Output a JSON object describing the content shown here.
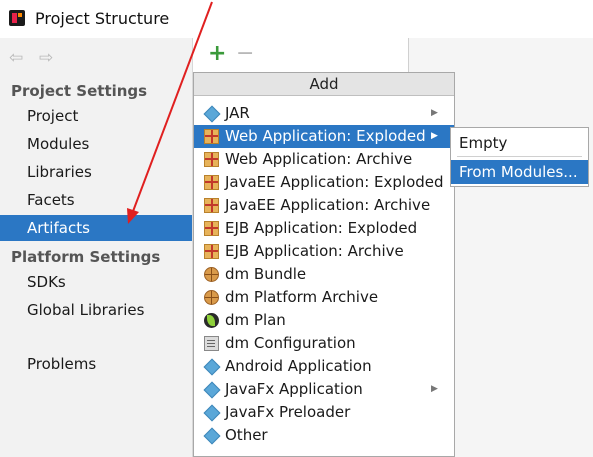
{
  "window": {
    "title": "Project Structure",
    "icon": "intellij-app-icon"
  },
  "nav_arrows": {
    "back": "⇦",
    "forward": "⇨"
  },
  "sidebar": {
    "project_settings_header": "Project Settings",
    "project_items": [
      {
        "label": "Project"
      },
      {
        "label": "Modules"
      },
      {
        "label": "Libraries"
      },
      {
        "label": "Facets"
      },
      {
        "label": "Artifacts",
        "selected": true
      }
    ],
    "platform_settings_header": "Platform Settings",
    "platform_items": [
      {
        "label": "SDKs"
      },
      {
        "label": "Global Libraries"
      }
    ],
    "problems_label": "Problems"
  },
  "toolbar": {
    "add_symbol": "+",
    "remove_symbol": "−"
  },
  "add_menu": {
    "header": "Add",
    "items": [
      {
        "label": "JAR",
        "icon": "jar-diamond-icon",
        "has_submenu": true
      },
      {
        "label": "Web Application: Exploded",
        "icon": "web-exploded-icon",
        "has_submenu": true,
        "highlighted": true
      },
      {
        "label": "Web Application: Archive",
        "icon": "web-archive-icon"
      },
      {
        "label": "JavaEE Application: Exploded",
        "icon": "javaee-exploded-icon"
      },
      {
        "label": "JavaEE Application: Archive",
        "icon": "javaee-archive-icon"
      },
      {
        "label": "EJB Application: Exploded",
        "icon": "ejb-exploded-icon"
      },
      {
        "label": "EJB Application: Archive",
        "icon": "ejb-archive-icon"
      },
      {
        "label": "dm Bundle",
        "icon": "dm-bundle-globe-icon"
      },
      {
        "label": "dm Platform Archive",
        "icon": "dm-platform-globe-icon"
      },
      {
        "label": "dm Plan",
        "icon": "dm-plan-leaf-icon"
      },
      {
        "label": "dm Configuration",
        "icon": "dm-configuration-doc-icon"
      },
      {
        "label": "Android Application",
        "icon": "android-diamond-icon"
      },
      {
        "label": "JavaFx Application",
        "icon": "javafx-diamond-icon",
        "has_submenu": true
      },
      {
        "label": "JavaFx Preloader",
        "icon": "javafx-preloader-diamond-icon"
      },
      {
        "label": "Other",
        "icon": "other-diamond-icon"
      }
    ],
    "submenu_arrow": "▶"
  },
  "submenu": {
    "items": [
      {
        "label": "Empty"
      },
      {
        "label": "From Modules...",
        "highlighted": true
      }
    ]
  },
  "colors": {
    "selection": "#2b77c4",
    "sidebar_bg": "#f2f2f2",
    "add_green": "#3a9a3a",
    "annotation_red": "#e02020"
  }
}
